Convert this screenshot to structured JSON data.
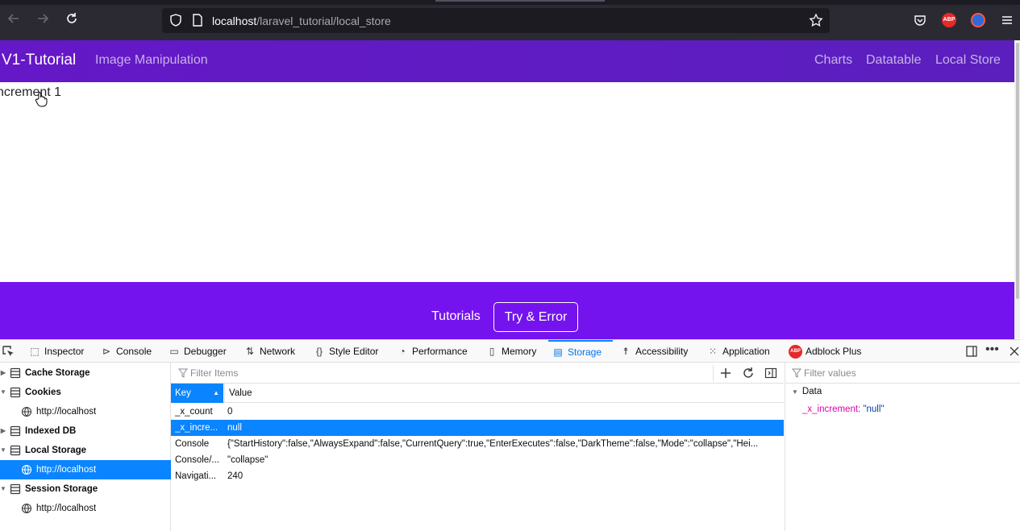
{
  "browser": {
    "url_host": "localhost",
    "url_path": "/laravel_tutorial/local_store",
    "back_icon": "arrow-left-icon",
    "forward_icon": "arrow-right-icon",
    "reload_icon": "reload-icon",
    "right_icons": [
      "pocket-icon",
      "adblock-plus-icon",
      "extension-icon",
      "menu-icon"
    ],
    "abp_label": "ABP"
  },
  "site_nav": {
    "brand": "V1-Tutorial",
    "left_links": [
      "Image Manipulation"
    ],
    "right_links": [
      "Charts",
      "Datatable",
      "Local Store"
    ]
  },
  "content": {
    "text": "ncrement 1"
  },
  "footer": {
    "link": "Tutorials",
    "button": "Try & Error"
  },
  "devtools": {
    "tabs": [
      {
        "label": "Inspector",
        "icon": "inspector-icon"
      },
      {
        "label": "Console",
        "icon": "console-icon"
      },
      {
        "label": "Debugger",
        "icon": "debugger-icon"
      },
      {
        "label": "Network",
        "icon": "network-icon"
      },
      {
        "label": "Style Editor",
        "icon": "style-editor-icon"
      },
      {
        "label": "Performance",
        "icon": "performance-icon"
      },
      {
        "label": "Memory",
        "icon": "memory-icon"
      },
      {
        "label": "Storage",
        "icon": "storage-icon",
        "active": true
      },
      {
        "label": "Accessibility",
        "icon": "accessibility-icon"
      },
      {
        "label": "Application",
        "icon": "application-icon"
      },
      {
        "label": "Adblock Plus",
        "icon": "adblock-plus-icon"
      }
    ],
    "abp_label": "ABP",
    "sidebar": [
      {
        "label": "Cache Storage",
        "group": true,
        "expanded": false
      },
      {
        "label": "Cookies",
        "group": true,
        "expanded": true
      },
      {
        "label": "http://localhost",
        "group": false
      },
      {
        "label": "Indexed DB",
        "group": true,
        "expanded": false
      },
      {
        "label": "Local Storage",
        "group": true,
        "expanded": true
      },
      {
        "label": "http://localhost",
        "group": false,
        "selected": true
      },
      {
        "label": "Session Storage",
        "group": true,
        "expanded": true
      },
      {
        "label": "http://localhost",
        "group": false
      }
    ],
    "filter_items_placeholder": "Filter Items",
    "table": {
      "headers": {
        "key": "Key",
        "value": "Value"
      },
      "rows": [
        {
          "key": "_x_count",
          "value": "0"
        },
        {
          "key": "_x_incre...",
          "value": "null",
          "selected": true
        },
        {
          "key": "Console",
          "value": "{\"StartHistory\":false,\"AlwaysExpand\":false,\"CurrentQuery\":true,\"EnterExecutes\":false,\"DarkTheme\":false,\"Mode\":\"collapse\",\"Hei..."
        },
        {
          "key": "Console/...",
          "value": "\"collapse\""
        },
        {
          "key": "Navigati...",
          "value": "240"
        }
      ]
    },
    "data_pane": {
      "filter_placeholder": "Filter values",
      "heading": "Data",
      "entry_key": "_x_increment",
      "entry_value": "\"null\""
    }
  }
}
